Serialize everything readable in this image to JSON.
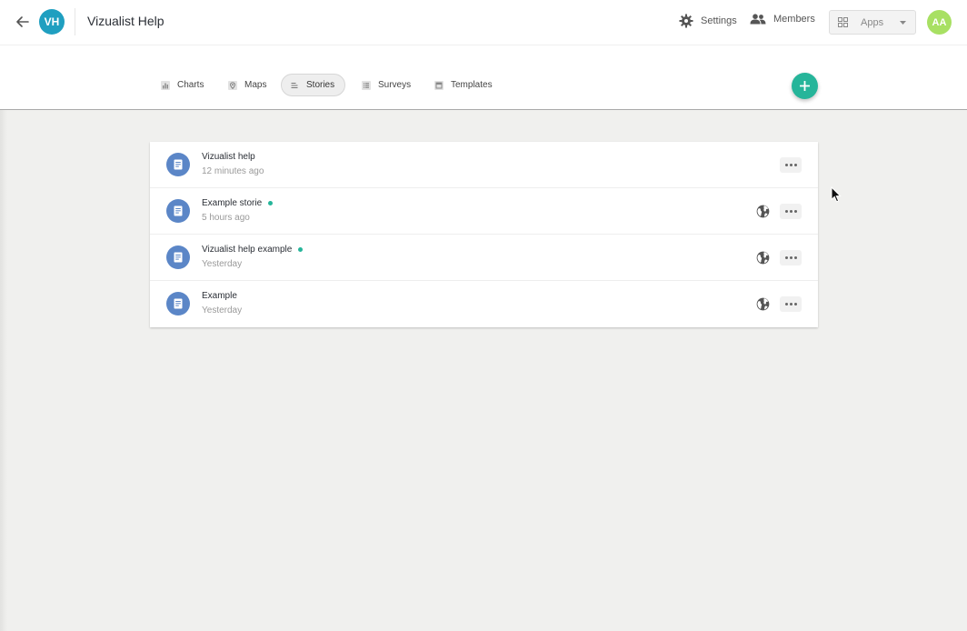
{
  "header": {
    "workspace_initials": "VH",
    "workspace_title": "Vizualist Help",
    "settings_label": "Settings",
    "members_label": "Members",
    "apps_label": "Apps",
    "user_initials": "AA"
  },
  "tabs": [
    {
      "label": "Charts",
      "icon": "bar-chart-icon",
      "active": false
    },
    {
      "label": "Maps",
      "icon": "map-pin-icon",
      "active": false
    },
    {
      "label": "Stories",
      "icon": "story-icon",
      "active": true
    },
    {
      "label": "Surveys",
      "icon": "survey-list-icon",
      "active": false
    },
    {
      "label": "Templates",
      "icon": "template-icon",
      "active": false
    }
  ],
  "stories": [
    {
      "title": "Vizualist help",
      "time": "12 minutes ago",
      "published": false
    },
    {
      "title": "Example storie",
      "time": "5 hours ago",
      "published": true
    },
    {
      "title": "Vizualist help example",
      "time": "Yesterday",
      "published": true
    },
    {
      "title": "Example",
      "time": "Yesterday",
      "published": true
    }
  ],
  "colors": {
    "accent": "#26b59a",
    "workspace_avatar": "#1f9fc0",
    "user_avatar": "#a8e063",
    "doc_icon": "#5b86c7"
  }
}
